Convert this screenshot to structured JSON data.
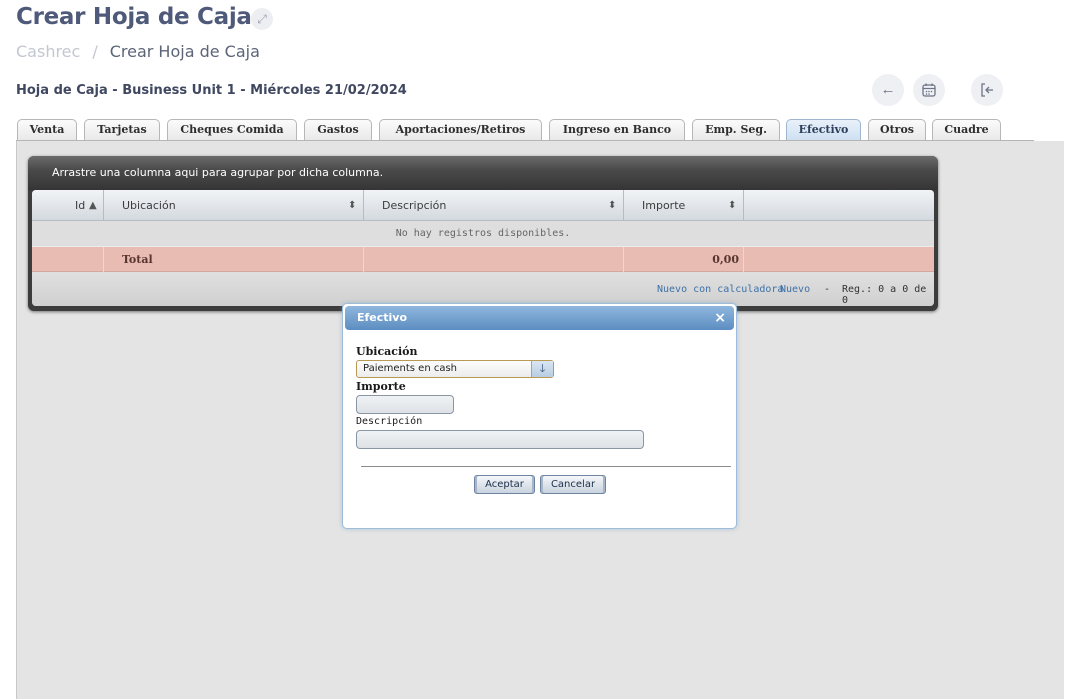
{
  "header": {
    "title": "Crear Hoja de Caja",
    "expand_icon": "expand-icon"
  },
  "breadcrumb": {
    "root": "Cashrec",
    "separator": "/",
    "current": "Crear Hoja de Caja"
  },
  "subheader": {
    "text": "Hoja de Caja - Business Unit 1 - Miércoles 21/02/2024"
  },
  "actions": {
    "back_icon": "arrow-left-icon",
    "calendar_icon": "calendar-icon",
    "exit_icon": "exit-icon"
  },
  "tabs": [
    {
      "label": "Venta"
    },
    {
      "label": "Tarjetas"
    },
    {
      "label": "Cheques Comida"
    },
    {
      "label": "Gastos"
    },
    {
      "label": "Aportaciones/Retiros"
    },
    {
      "label": "Ingreso en Banco"
    },
    {
      "label": "Emp. Seg."
    },
    {
      "label": "Efectivo",
      "active": true
    },
    {
      "label": "Otros"
    },
    {
      "label": "Cuadre"
    }
  ],
  "grid": {
    "group_hint": "Arrastre una columna aqui para agrupar por dicha columna.",
    "columns": [
      "Id",
      "Ubicación",
      "Descripción",
      "Importe"
    ],
    "no_records": "No hay registros disponibles.",
    "total_label": "Total",
    "total_value": "0,00",
    "pager": {
      "new_calc": "Nuevo con calculadora",
      "new": "Nuevo",
      "dash": "-",
      "records": "Reg.: 0 a 0 de 0"
    }
  },
  "dialog": {
    "title": "Efectivo",
    "close": "×",
    "ubicacion_label": "Ubicación",
    "ubicacion_value": "Paiements en cash",
    "importe_label": "Importe",
    "importe_value": "",
    "descripcion_label": "Descripción",
    "descripcion_value": "",
    "accept": "Aceptar",
    "cancel": "Cancelar"
  }
}
